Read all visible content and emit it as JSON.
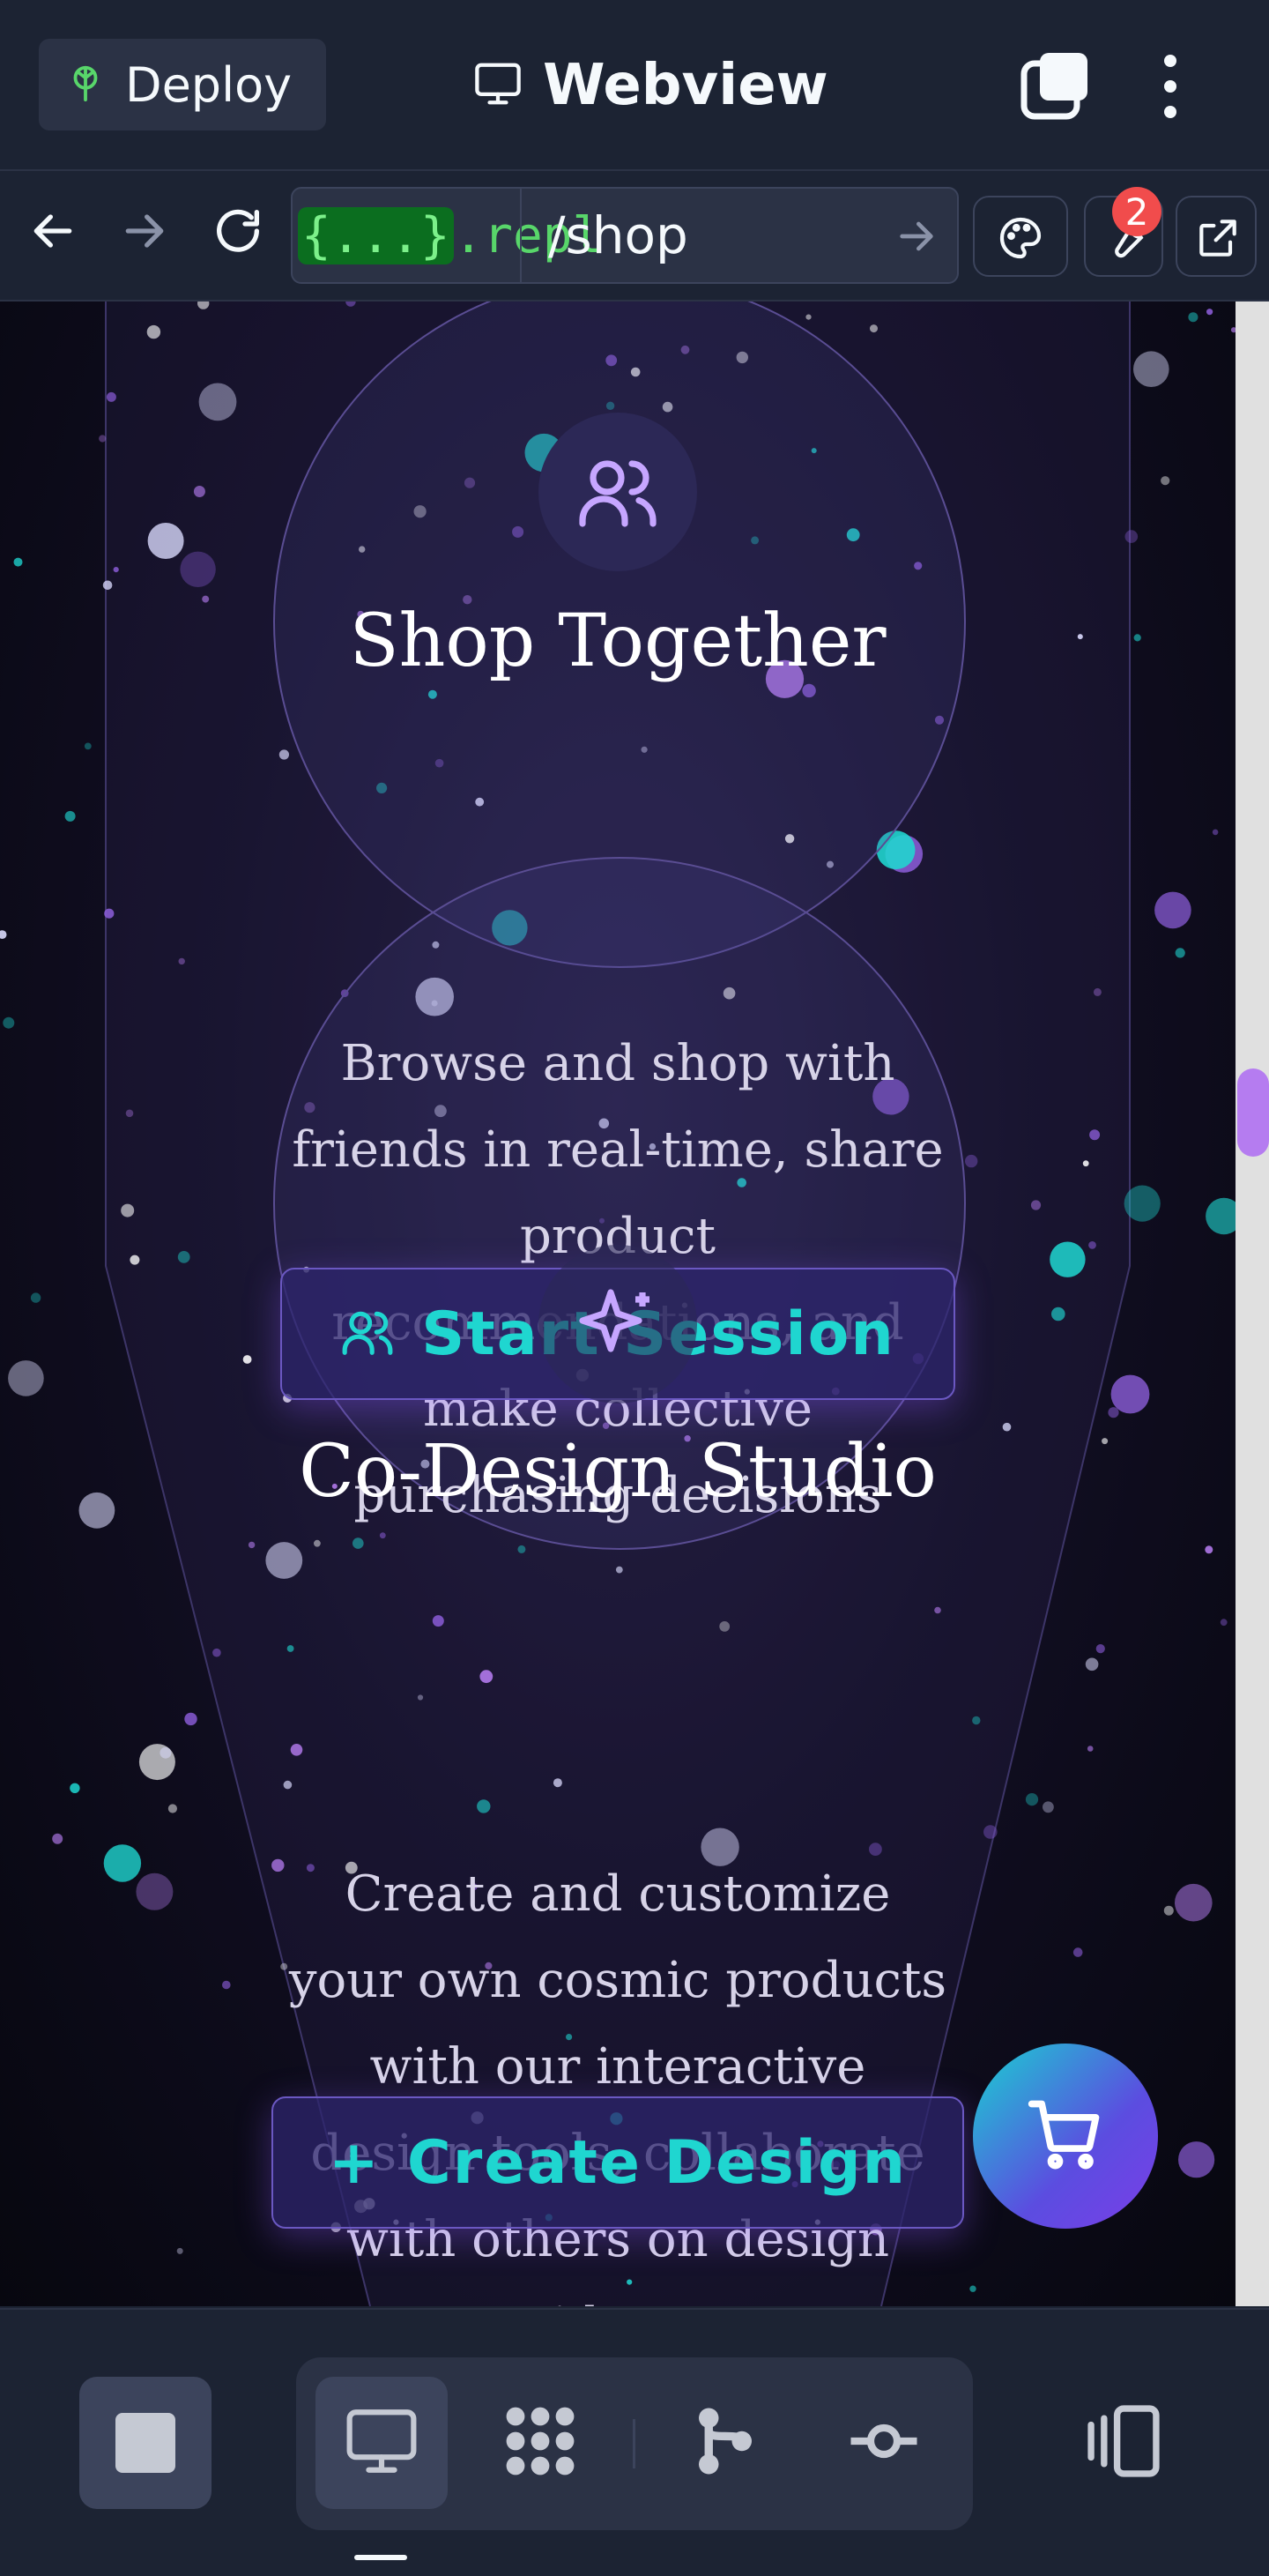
{
  "topbar": {
    "deploy_label": "Deploy",
    "title": "Webview"
  },
  "address": {
    "host_curly": "{...}",
    "host_suffix": ".repl",
    "path": "/shop",
    "notification_count": "2"
  },
  "cards": [
    {
      "title": "Shop Together",
      "description": "Browse and shop with friends in real-time, share product recommendations, and make collective purchasing decisions",
      "button_label": "Start Session",
      "icon": "users-icon"
    },
    {
      "title": "Co-Design Studio",
      "description": "Create and customize your own cosmic products with our interactive design tools, collaborate with others on design ideas",
      "button_label": "Create Design",
      "button_prefix": "+",
      "icon": "sparkles-icon"
    }
  ],
  "fab": {
    "icon": "shopping-cart-icon"
  },
  "bottom_toolbar": {
    "items": [
      "stop",
      "webview",
      "workflows",
      "git",
      "commits",
      "layout"
    ]
  },
  "colors": {
    "accent_cyan": "#1fd6d0",
    "accent_purple": "#b57cf0",
    "toolbar_bg": "#1c2333"
  }
}
